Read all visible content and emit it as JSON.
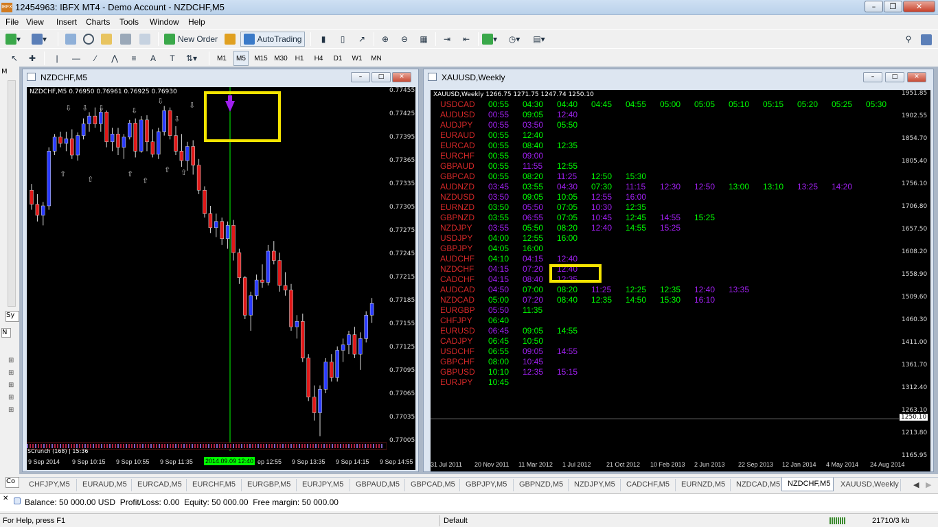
{
  "window": {
    "title": "12454963: IBFX MT4 - Demo Account - NZDCHF,M5",
    "logo_text": "IBFX"
  },
  "menu": [
    "File",
    "View",
    "Insert",
    "Charts",
    "Tools",
    "Window",
    "Help"
  ],
  "toolbar": {
    "new_order": "New Order",
    "autotrading": "AutoTrading"
  },
  "timeframes": [
    "M1",
    "M5",
    "M15",
    "M30",
    "H1",
    "H4",
    "D1",
    "W1",
    "MN"
  ],
  "left_tabs": {
    "a": "M",
    "b": "Sy",
    "c": "N",
    "d": "Co"
  },
  "chart1": {
    "title": "NZDCHF,M5",
    "ohlc": "NZDCHF,M5  0.76950 0.76961 0.76925 0.76930",
    "price_labels": [
      "0.77455",
      "0.77425",
      "0.77395",
      "0.77365",
      "0.77335",
      "0.77305",
      "0.77275",
      "0.77245",
      "0.77215",
      "0.77185",
      "0.77155",
      "0.77125",
      "0.77095",
      "0.77065",
      "0.77035",
      "0.77005"
    ],
    "time_labels": [
      "9 Sep 2014",
      "9 Sep 10:15",
      "9 Sep 10:55",
      "9 Sep 11:35",
      "2014.09.09 12:40",
      "ep 12:55",
      "9 Sep 13:35",
      "9 Sep 14:15",
      "9 Sep 14:55"
    ],
    "highlight_time": "2014.09.09 12:40",
    "footer": "SCrunch (168) | 15:36",
    "accent": "#00ff00"
  },
  "chart2": {
    "title": "XAUUSD,Weekly",
    "ohlc": "XAUUSD,Weekly  1266.75 1271.75 1247.74 1250.10",
    "price_labels": [
      "1951.85",
      "1902.55",
      "1854.70",
      "1805.40",
      "1756.10",
      "1706.80",
      "1657.50",
      "1608.20",
      "1558.90",
      "1509.60",
      "1460.30",
      "1411.00",
      "1361.70",
      "1312.40",
      "1263.10",
      "1213.80",
      "1165.95"
    ],
    "current_price": "1250.10",
    "time_labels": [
      "31 Jul 2011",
      "20 Nov 2011",
      "11 Mar 2012",
      "1 Jul 2012",
      "21 Oct 2012",
      "10 Feb 2013",
      "2 Jun 2013",
      "22 Sep 2013",
      "12 Jan 2014",
      "4 May 2014",
      "24 Aug 2014"
    ],
    "colors": {
      "pair": "#d42828",
      "green": "#00ff00",
      "purple": "#a020f0"
    },
    "schedule": [
      {
        "pair": "USDCAD",
        "times": [
          [
            "00:55",
            "g"
          ],
          [
            "04:30",
            "g"
          ],
          [
            "04:40",
            "g"
          ],
          [
            "04:45",
            "g"
          ],
          [
            "04:55",
            "g"
          ],
          [
            "05:00",
            "g"
          ],
          [
            "05:05",
            "g"
          ],
          [
            "05:10",
            "g"
          ],
          [
            "05:15",
            "g"
          ],
          [
            "05:20",
            "g"
          ],
          [
            "05:25",
            "g"
          ],
          [
            "05:30",
            "g"
          ]
        ]
      },
      {
        "pair": "AUDUSD",
        "times": [
          [
            "00:55",
            "p"
          ],
          [
            "09:05",
            "g"
          ],
          [
            "12:40",
            "p"
          ]
        ]
      },
      {
        "pair": "AUDJPY",
        "times": [
          [
            "00:55",
            "p"
          ],
          [
            "03:50",
            "p"
          ],
          [
            "05:50",
            "g"
          ]
        ]
      },
      {
        "pair": "EURAUD",
        "times": [
          [
            "00:55",
            "g"
          ],
          [
            "12:40",
            "g"
          ]
        ]
      },
      {
        "pair": "EURCAD",
        "times": [
          [
            "00:55",
            "g"
          ],
          [
            "08:40",
            "g"
          ],
          [
            "12:35",
            "g"
          ]
        ]
      },
      {
        "pair": "EURCHF",
        "times": [
          [
            "00:55",
            "g"
          ],
          [
            "09:00",
            "p"
          ]
        ]
      },
      {
        "pair": "GBPAUD",
        "times": [
          [
            "00:55",
            "g"
          ],
          [
            "11:55",
            "p"
          ],
          [
            "12:55",
            "g"
          ]
        ]
      },
      {
        "pair": "GBPCAD",
        "times": [
          [
            "00:55",
            "g"
          ],
          [
            "08:20",
            "g"
          ],
          [
            "11:25",
            "p"
          ],
          [
            "12:50",
            "g"
          ],
          [
            "15:30",
            "g"
          ]
        ]
      },
      {
        "pair": "AUDNZD",
        "times": [
          [
            "03:45",
            "p"
          ],
          [
            "03:55",
            "g"
          ],
          [
            "04:30",
            "p"
          ],
          [
            "07:30",
            "g"
          ],
          [
            "11:15",
            "p"
          ],
          [
            "12:30",
            "p"
          ],
          [
            "12:50",
            "p"
          ],
          [
            "13:00",
            "g"
          ],
          [
            "13:10",
            "g"
          ],
          [
            "13:25",
            "p"
          ],
          [
            "14:20",
            "p"
          ]
        ]
      },
      {
        "pair": "NZDUSD",
        "times": [
          [
            "03:50",
            "p"
          ],
          [
            "09:05",
            "g"
          ],
          [
            "10:05",
            "g"
          ],
          [
            "12:55",
            "p"
          ],
          [
            "16:00",
            "p"
          ]
        ]
      },
      {
        "pair": "EURNZD",
        "times": [
          [
            "03:50",
            "g"
          ],
          [
            "05:50",
            "p"
          ],
          [
            "07:05",
            "g"
          ],
          [
            "10:30",
            "p"
          ],
          [
            "12:35",
            "g"
          ]
        ]
      },
      {
        "pair": "GBPNZD",
        "times": [
          [
            "03:55",
            "g"
          ],
          [
            "06:55",
            "p"
          ],
          [
            "07:05",
            "g"
          ],
          [
            "10:45",
            "p"
          ],
          [
            "12:45",
            "g"
          ],
          [
            "14:55",
            "p"
          ],
          [
            "15:25",
            "g"
          ]
        ]
      },
      {
        "pair": "NZDJPY",
        "times": [
          [
            "03:55",
            "p"
          ],
          [
            "05:50",
            "g"
          ],
          [
            "08:20",
            "g"
          ],
          [
            "12:40",
            "p"
          ],
          [
            "14:55",
            "g"
          ],
          [
            "15:25",
            "p"
          ]
        ]
      },
      {
        "pair": "USDJPY",
        "times": [
          [
            "04:00",
            "g"
          ],
          [
            "12:55",
            "g"
          ],
          [
            "16:00",
            "g"
          ]
        ]
      },
      {
        "pair": "GBPJPY",
        "times": [
          [
            "04:05",
            "g"
          ],
          [
            "16:00",
            "g"
          ]
        ]
      },
      {
        "pair": "AUDCHF",
        "times": [
          [
            "04:10",
            "g"
          ],
          [
            "04:15",
            "p"
          ],
          [
            "12:40",
            "p"
          ]
        ]
      },
      {
        "pair": "NZDCHF",
        "times": [
          [
            "04:15",
            "p"
          ],
          [
            "07:20",
            "p"
          ],
          [
            "12:40",
            "p"
          ]
        ]
      },
      {
        "pair": "CADCHF",
        "times": [
          [
            "04:15",
            "p"
          ],
          [
            "08:40",
            "p"
          ],
          [
            "12:35",
            "p"
          ]
        ]
      },
      {
        "pair": "AUDCAD",
        "times": [
          [
            "04:50",
            "p"
          ],
          [
            "07:00",
            "g"
          ],
          [
            "08:20",
            "g"
          ],
          [
            "11:25",
            "p"
          ],
          [
            "12:25",
            "g"
          ],
          [
            "12:35",
            "g"
          ],
          [
            "12:40",
            "p"
          ],
          [
            "13:35",
            "p"
          ]
        ]
      },
      {
        "pair": "NZDCAD",
        "times": [
          [
            "05:00",
            "g"
          ],
          [
            "07:20",
            "p"
          ],
          [
            "08:40",
            "g"
          ],
          [
            "12:35",
            "g"
          ],
          [
            "14:50",
            "g"
          ],
          [
            "15:30",
            "g"
          ],
          [
            "16:10",
            "p"
          ]
        ]
      },
      {
        "pair": "EURGBP",
        "times": [
          [
            "05:50",
            "p"
          ],
          [
            "11:35",
            "g"
          ]
        ]
      },
      {
        "pair": "CHFJPY",
        "times": [
          [
            "06:40",
            "g"
          ]
        ]
      },
      {
        "pair": "EURUSD",
        "times": [
          [
            "06:45",
            "p"
          ],
          [
            "09:05",
            "g"
          ],
          [
            "14:55",
            "g"
          ]
        ]
      },
      {
        "pair": "CADJPY",
        "times": [
          [
            "06:45",
            "g"
          ],
          [
            "10:50",
            "g"
          ]
        ]
      },
      {
        "pair": "USDCHF",
        "times": [
          [
            "06:55",
            "g"
          ],
          [
            "09:05",
            "p"
          ],
          [
            "14:55",
            "p"
          ]
        ]
      },
      {
        "pair": "GBPCHF",
        "times": [
          [
            "08:00",
            "g"
          ],
          [
            "10:45",
            "p"
          ]
        ]
      },
      {
        "pair": "GBPUSD",
        "times": [
          [
            "10:10",
            "g"
          ],
          [
            "12:35",
            "p"
          ],
          [
            "15:15",
            "p"
          ]
        ]
      },
      {
        "pair": "EURJPY",
        "times": [
          [
            "10:45",
            "g"
          ]
        ]
      }
    ]
  },
  "tabs": [
    "CHFJPY,M5",
    "EURAUD,M5",
    "EURCAD,M5",
    "EURCHF,M5",
    "EURGBP,M5",
    "EURJPY,M5",
    "GBPAUD,M5",
    "GBPCAD,M5",
    "GBPJPY,M5",
    "GBPNZD,M5",
    "NZDJPY,M5",
    "CADCHF,M5",
    "EURNZD,M5",
    "NZDCAD,M5",
    "NZDCHF,M5",
    "XAUUSD,Weekly"
  ],
  "active_tab": "NZDCHF,M5",
  "balance": "Balance: 50 000.00 USD  Profit/Loss: 0.00  Equity: 50 000.00  Free margin: 50 000.00",
  "status": {
    "help": "For Help, press F1",
    "profile": "Default",
    "kb": "21710/3 kb"
  },
  "candles_nzdchf": [
    [
      0.7733,
      0.77338,
      0.77305,
      0.77312
    ],
    [
      0.77312,
      0.77325,
      0.7729,
      0.77298
    ],
    [
      0.77298,
      0.77315,
      0.77285,
      0.7731
    ],
    [
      0.7731,
      0.77385,
      0.77305,
      0.7738
    ],
    [
      0.7738,
      0.77402,
      0.77375,
      0.77398
    ],
    [
      0.77398,
      0.77405,
      0.77385,
      0.7739
    ],
    [
      0.7739,
      0.77405,
      0.7738,
      0.77396
    ],
    [
      0.77396,
      0.77408,
      0.7737,
      0.77375
    ],
    [
      0.77375,
      0.77404,
      0.77368,
      0.774
    ],
    [
      0.774,
      0.77422,
      0.77395,
      0.77415
    ],
    [
      0.77415,
      0.7743,
      0.77405,
      0.77425
    ],
    [
      0.77425,
      0.77436,
      0.7741,
      0.77415
    ],
    [
      0.77415,
      0.77435,
      0.77405,
      0.7743
    ],
    [
      0.7743,
      0.77432,
      0.77385,
      0.77392
    ],
    [
      0.77392,
      0.7741,
      0.7738,
      0.77402
    ],
    [
      0.77402,
      0.7741,
      0.77375,
      0.77385
    ],
    [
      0.77385,
      0.77402,
      0.7737,
      0.77398
    ],
    [
      0.77398,
      0.7742,
      0.77395,
      0.77416
    ],
    [
      0.77416,
      0.77422,
      0.77372,
      0.7738
    ],
    [
      0.7738,
      0.77425,
      0.77378,
      0.7742
    ],
    [
      0.7742,
      0.77426,
      0.7738,
      0.77392
    ],
    [
      0.77392,
      0.77408,
      0.77372,
      0.77376
    ],
    [
      0.77376,
      0.7741,
      0.7737,
      0.77405
    ],
    [
      0.77405,
      0.77438,
      0.774,
      0.77432
    ],
    [
      0.77432,
      0.77436,
      0.77395,
      0.774
    ],
    [
      0.774,
      0.77412,
      0.77375,
      0.7738
    ],
    [
      0.7738,
      0.77402,
      0.7736,
      0.77368
    ],
    [
      0.77368,
      0.77392,
      0.77355,
      0.77386
    ],
    [
      0.77386,
      0.77394,
      0.7735,
      0.77362
    ],
    [
      0.77362,
      0.7737,
      0.77325,
      0.7733
    ],
    [
      0.7733,
      0.77335,
      0.77295,
      0.773
    ],
    [
      0.773,
      0.7731,
      0.77275,
      0.77282
    ],
    [
      0.77282,
      0.773,
      0.7727,
      0.7729
    ],
    [
      0.7729,
      0.77295,
      0.7726,
      0.77268
    ],
    [
      0.77268,
      0.7729,
      0.77255,
      0.77285
    ],
    [
      0.77285,
      0.77292,
      0.7724,
      0.7725
    ],
    [
      0.7725,
      0.77255,
      0.7721,
      0.77218
    ],
    [
      0.77218,
      0.7722,
      0.77165,
      0.7717
    ],
    [
      0.7717,
      0.772,
      0.7715,
      0.77195
    ],
    [
      0.77195,
      0.77222,
      0.7719,
      0.77215
    ],
    [
      0.77215,
      0.77235,
      0.77205,
      0.77212
    ],
    [
      0.77212,
      0.7726,
      0.77208,
      0.77252
    ],
    [
      0.77252,
      0.77265,
      0.77235,
      0.7724
    ],
    [
      0.7724,
      0.7725,
      0.772,
      0.77208
    ],
    [
      0.77208,
      0.77225,
      0.77195,
      0.77202
    ],
    [
      0.77202,
      0.7721,
      0.7715,
      0.77155
    ],
    [
      0.77155,
      0.7717,
      0.7714,
      0.77162
    ],
    [
      0.77162,
      0.77172,
      0.7711,
      0.77115
    ],
    [
      0.77115,
      0.7712,
      0.7706,
      0.77065
    ],
    [
      0.77065,
      0.7708,
      0.77035,
      0.77045
    ],
    [
      0.77045,
      0.7708,
      0.77015,
      0.77075
    ],
    [
      0.77075,
      0.77115,
      0.7707,
      0.7711
    ],
    [
      0.7711,
      0.7712,
      0.77085,
      0.7709
    ],
    [
      0.7709,
      0.7713,
      0.77085,
      0.77125
    ],
    [
      0.77125,
      0.7714,
      0.7711,
      0.77132
    ],
    [
      0.77132,
      0.7715,
      0.7712,
      0.77145
    ],
    [
      0.77145,
      0.77155,
      0.77115,
      0.7712
    ],
    [
      0.7712,
      0.77148,
      0.771,
      0.7714
    ],
    [
      0.7714,
      0.77175,
      0.77135,
      0.7717
    ],
    [
      0.7717,
      0.77192,
      0.7716,
      0.77185
    ]
  ]
}
